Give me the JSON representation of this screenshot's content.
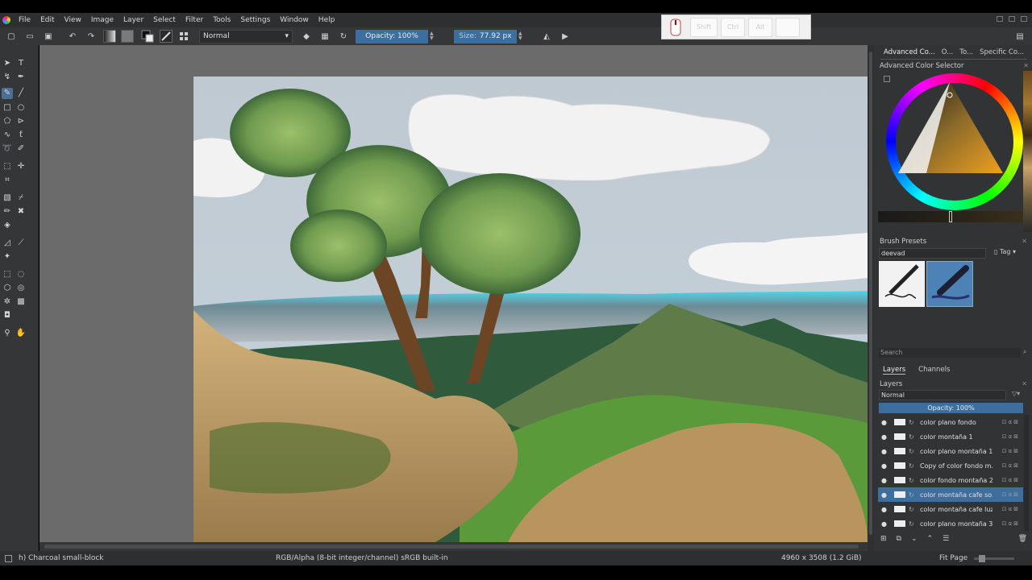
{
  "menu": [
    "File",
    "Edit",
    "View",
    "Image",
    "Layer",
    "Select",
    "Filter",
    "Tools",
    "Settings",
    "Window",
    "Help"
  ],
  "toolbar": {
    "blend_mode": "Normal",
    "opacity_label": "Opacity: 100%",
    "opacity_value": 1.0,
    "size_label": "Size:",
    "size_value": "77.92 px"
  },
  "key_visualizer": {
    "keys": [
      "Shift",
      "Ctrl",
      "Alt",
      ""
    ]
  },
  "dock": {
    "top_tabs": [
      "Advanced Co...",
      "O...",
      "To...",
      "Specific Co..."
    ],
    "color_selector_title": "Advanced Color Selector",
    "brush_presets_title": "Brush Presets",
    "brush_tag": "deevad",
    "tag_label": "Tag",
    "search_placeholder": "Search",
    "layer_tabs": [
      "Layers",
      "Channels"
    ],
    "layers_title": "Layers",
    "layer_blend": "Normal",
    "layer_opacity": "Opacity: 100%"
  },
  "layers": [
    {
      "name": "color plano fondo",
      "selected": false
    },
    {
      "name": "color montaña 1",
      "selected": false
    },
    {
      "name": "color plano montaña 1",
      "selected": false
    },
    {
      "name": "Copy of color fondo m...",
      "selected": false
    },
    {
      "name": "color fondo montaña 2",
      "selected": false
    },
    {
      "name": "color montaña cafe so...",
      "selected": true
    },
    {
      "name": "color montaña cafe luz",
      "selected": false
    },
    {
      "name": "color plano montaña 3",
      "selected": false
    }
  ],
  "status": {
    "brush": "h) Charcoal small-block",
    "color_space": "RGB/Alpha (8-bit integer/channel)  sRGB built-in",
    "dimensions": "4960 x 3508 (1.2 GiB)",
    "zoom": "Fit Page"
  },
  "colors": {
    "accent": "#3d6e9d",
    "panel": "#323334",
    "canvas_bg": "#6b6b6b"
  }
}
